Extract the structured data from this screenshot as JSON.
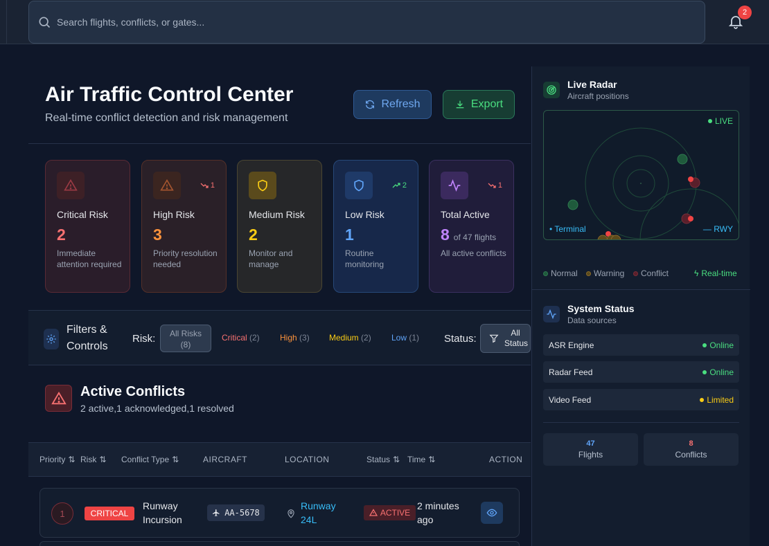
{
  "search": {
    "placeholder": "Search flights, conflicts, or gates..."
  },
  "notifications": {
    "count": "2"
  },
  "header": {
    "title": "Air Traffic Control Center",
    "subtitle": "Real-time conflict detection and risk management",
    "refresh_label": "Refresh",
    "export_label": "Export"
  },
  "cards": [
    {
      "label": "Critical Risk",
      "value": "2",
      "desc": "Immediate attention required",
      "trend": "",
      "color": "#f87171"
    },
    {
      "label": "High Risk",
      "value": "3",
      "desc": "Priority resolution needed",
      "trend": "1",
      "color": "#fb923c"
    },
    {
      "label": "Medium Risk",
      "value": "2",
      "desc": "Monitor and manage",
      "trend": "",
      "color": "#facc15"
    },
    {
      "label": "Low Risk",
      "value": "1",
      "desc": "Routine monitoring",
      "trend": "2",
      "color": "#60a5fa"
    },
    {
      "label": "Total Active",
      "value": "8",
      "sub": "of 47 flights",
      "desc": "All active conflicts",
      "trend": "1",
      "color": "#c084fc"
    }
  ],
  "filters": {
    "title": "Filters & Controls",
    "risk_label": "Risk:",
    "all_risks": "All Risks",
    "all_risks_count": "(8)",
    "chips": [
      {
        "label": "Critical",
        "count": "(2)",
        "color": "#f87171"
      },
      {
        "label": "High",
        "count": "(3)",
        "color": "#fb923c"
      },
      {
        "label": "Medium",
        "count": "(2)",
        "color": "#facc15"
      },
      {
        "label": "Low",
        "count": "(1)",
        "color": "#60a5fa"
      }
    ],
    "status_label": "Status:",
    "all_status": "All Status"
  },
  "active_conflicts": {
    "title": "Active Conflicts",
    "summary": "2 active,1 acknowledged,1 resolved"
  },
  "table": {
    "headers": [
      "Priority",
      "Risk",
      "Conflict Type",
      "AIRCRAFT",
      "LOCATION",
      "Status",
      "Time",
      "ACTION"
    ],
    "rows": [
      {
        "priority": "1",
        "risk": "CRITICAL",
        "type": "Runway Incursion",
        "aircraft": "AA-5678",
        "location": "Runway 24L",
        "status": "ACTIVE",
        "time": "2 minutes ago"
      }
    ]
  },
  "radar": {
    "title": "Live Radar",
    "subtitle": "Aircraft positions",
    "live": "LIVE",
    "terminal": "Terminal",
    "runway": "RWY",
    "legend": [
      "Normal",
      "Warning",
      "Conflict"
    ],
    "realtime": "Real-time"
  },
  "system_status": {
    "title": "System Status",
    "subtitle": "Data sources",
    "items": [
      {
        "name": "ASR Engine",
        "status": "Online",
        "color": "#4ade80"
      },
      {
        "name": "Radar Feed",
        "status": "Online",
        "color": "#4ade80"
      },
      {
        "name": "Video Feed",
        "status": "Limited",
        "color": "#facc15"
      }
    ],
    "flights_value": "47",
    "flights_label": "Flights",
    "conflicts_value": "8",
    "conflicts_label": "Conflicts"
  }
}
